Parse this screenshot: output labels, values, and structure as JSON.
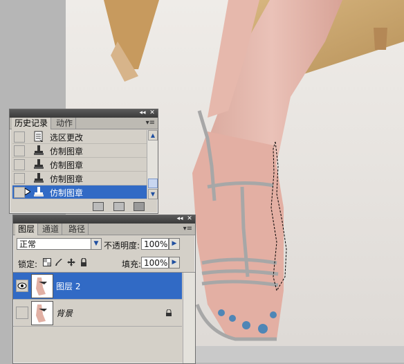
{
  "history_panel": {
    "tabs": [
      {
        "label": "历史记录",
        "active": true
      },
      {
        "label": "动作",
        "active": false
      }
    ],
    "items": [
      {
        "label": "选区更改",
        "icon": "document-icon",
        "selected": false
      },
      {
        "label": "仿制图章",
        "icon": "clone-stamp-icon",
        "selected": false
      },
      {
        "label": "仿制图章",
        "icon": "clone-stamp-icon",
        "selected": false
      },
      {
        "label": "仿制图章",
        "icon": "clone-stamp-icon",
        "selected": false
      },
      {
        "label": "仿制图章",
        "icon": "clone-stamp-icon",
        "selected": true
      }
    ]
  },
  "layers_panel": {
    "tabs": [
      {
        "label": "图层",
        "active": true
      },
      {
        "label": "通道",
        "active": false
      },
      {
        "label": "路径",
        "active": false
      }
    ],
    "blend_mode": "正常",
    "opacity_label": "不透明度:",
    "opacity_value": "100%",
    "lock_label": "锁定:",
    "fill_label": "填充:",
    "fill_value": "100%",
    "layers": [
      {
        "name": "图层 2",
        "selected": true,
        "visible": true,
        "locked": false
      },
      {
        "name": "背景",
        "selected": false,
        "visible": false,
        "locked": true
      }
    ]
  },
  "colors": {
    "selection": "#316ac5",
    "panel_bg": "#d4d0c8",
    "titlebar": "#3a3a3a"
  }
}
